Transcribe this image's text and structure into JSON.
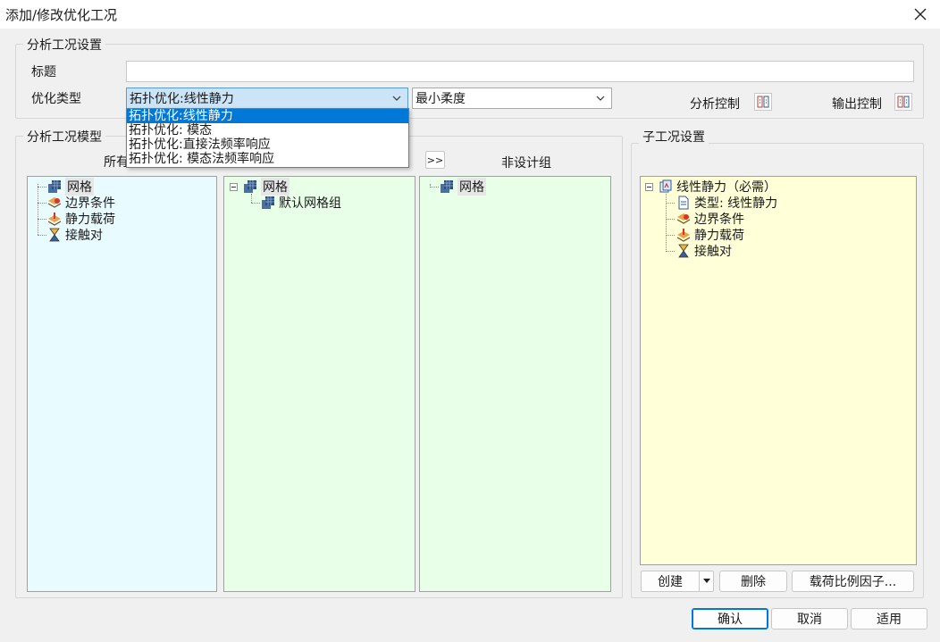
{
  "window": {
    "title": "添加/修改优化工况"
  },
  "analysis_settings": {
    "group_label": "分析工况设置",
    "title_label": "标题",
    "title_value": "",
    "opt_type_label": "优化类型",
    "opt_type_value": "拓扑优化:线性静力",
    "opt_target_value": "最小柔度",
    "dropdown_options": [
      "拓扑优化:线性静力",
      "拓扑优化: 模态",
      "拓扑优化:直接法频率响应",
      "拓扑优化: 模态法频率响应"
    ],
    "analysis_control_label": "分析控制",
    "output_control_label": "输出控制"
  },
  "model": {
    "group_label": "分析工况模型",
    "all_label": "所有",
    "move_button": ">>",
    "non_design_label": "非设计组",
    "left_tree": [
      "网格",
      "边界条件",
      "静力载荷",
      "接触对"
    ],
    "middle_tree": {
      "root": "网格",
      "child": "默认网格组"
    },
    "right_tree": [
      "网格"
    ]
  },
  "subcase": {
    "group_label": "子工况设置",
    "root": "线性静力（必需）",
    "children": [
      "类型: 线性静力",
      "边界条件",
      "静力载荷",
      "接触对"
    ],
    "create_button": "创建",
    "delete_button": "删除",
    "scale_button": "载荷比例因子..."
  },
  "footer": {
    "ok": "确认",
    "cancel": "取消",
    "apply": "适用"
  },
  "colors": {
    "left_panel": "#e8fbff",
    "middle_panel": "#e8ffe8",
    "right_panel": "#e8ffe8",
    "subcase_panel": "#ffffd8",
    "selection": "#0078d7"
  }
}
